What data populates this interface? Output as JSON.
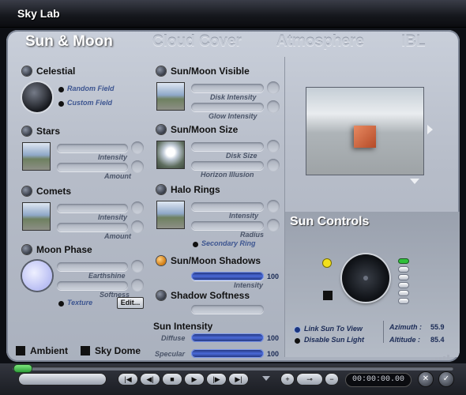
{
  "window": {
    "title": "Sky Lab"
  },
  "tabs": [
    "Sun & Moon",
    "Cloud Cover",
    "Atmosphere",
    "IBL"
  ],
  "celestial": {
    "label": "Celestial",
    "options": [
      "Random Field",
      "Custom Field"
    ]
  },
  "stars": {
    "label": "Stars",
    "sliders": [
      "Intensity",
      "Amount"
    ]
  },
  "comets": {
    "label": "Comets",
    "sliders": [
      "Intensity",
      "Amount"
    ]
  },
  "moon_phase": {
    "label": "Moon Phase",
    "sliders": [
      "Earthshine",
      "Softness"
    ],
    "texture_label": "Texture",
    "edit_button": "Edit..."
  },
  "sun_moon_visible": {
    "label": "Sun/Moon Visible",
    "sliders": [
      "Disk Intensity",
      "Glow Intensity"
    ]
  },
  "sun_moon_size": {
    "label": "Sun/Moon Size",
    "sliders": [
      "Disk Size",
      "Horizon Illusion"
    ]
  },
  "halo_rings": {
    "label": "Halo Rings",
    "sliders": [
      "Intensity",
      "Radius"
    ],
    "option": "Secondary Ring"
  },
  "sun_moon_shadows": {
    "label": "Sun/Moon Shadows",
    "slider_label": "Intensity",
    "value": "100",
    "fraction": 1.0
  },
  "shadow_softness": {
    "label": "Shadow Softness"
  },
  "sun_intensity": {
    "label": "Sun Intensity",
    "diffuse_label": "Diffuse",
    "diffuse_value": "100",
    "specular_label": "Specular",
    "specular_value": "100"
  },
  "bottom_toggles": {
    "ambient": "Ambient",
    "sky_dome": "Sky Dome"
  },
  "sun_controls": {
    "title": "Sun Controls",
    "link_label": "Link Sun To View",
    "disable_label": "Disable Sun Light",
    "azimuth_label": "Azimuth :",
    "azimuth_value": "55.9",
    "altitude_label": "Altitude :",
    "altitude_value": "85.4"
  },
  "transport": {
    "timecode": "00:00:00.00"
  },
  "icons": [
    "expand-right-icon",
    "expand-down-icon",
    "play-icon",
    "stop-icon",
    "key-icon",
    "close-icon",
    "check-icon"
  ],
  "colors": {
    "accent_blue": "#4a6ad8",
    "sun_yellow": "#f2e01a",
    "shadow_led": "#d07a10"
  }
}
